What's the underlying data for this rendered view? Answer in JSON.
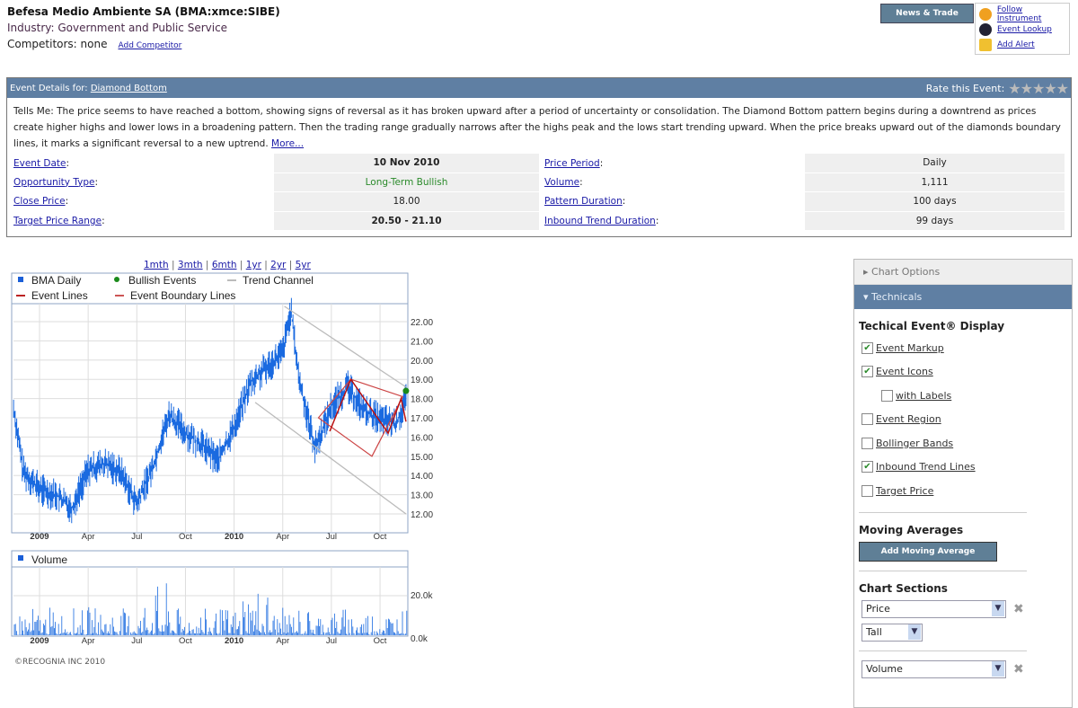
{
  "header": {
    "title": "Befesa Medio Ambiente SA (BMA:xmce:SIBE)",
    "industry": "Industry: Government and Public Service",
    "competitors": "Competitors: none",
    "add_competitor": "Add Competitor"
  },
  "actions": {
    "news_trade": "News & Trade",
    "follow": "Follow Instrument",
    "lookup": "Event Lookup",
    "alert": "Add Alert"
  },
  "event": {
    "label": "Event Details for:",
    "name": "Diamond Bottom",
    "rate_label": "Rate this Event:",
    "rating": 0,
    "tells": "Tells Me: The price seems to have reached a bottom, showing signs of reversal as it has broken upward after a period of uncertainty or consolidation. The Diamond Bottom pattern begins during a downtrend as prices create higher highs and lower lows in a broadening pattern. Then the trading range gradually narrows after the highs peak and the lows start trending upward. When the price breaks upward out of the diamonds boundary lines, it marks a significant reversal to a new uptrend.",
    "more": "More...",
    "rows": [
      {
        "l1": "Event Date",
        "v1": "10 Nov 2010",
        "l2": "Price Period",
        "v2": "Daily"
      },
      {
        "l1": "Opportunity Type",
        "v1": "Long-Term Bullish",
        "l2": "Volume",
        "v2": "1,111"
      },
      {
        "l1": "Close Price",
        "v1": "18.00",
        "l2": "Pattern Duration",
        "v2": "100 days"
      },
      {
        "l1": "Target Price Range",
        "v1": "20.50 - 21.10",
        "l2": "Inbound Trend Duration",
        "v2": "99 days"
      }
    ]
  },
  "ranges": [
    "1mth",
    "3mth",
    "6mth",
    "1yr",
    "2yr",
    "5yr"
  ],
  "chart_data": {
    "type": "line",
    "legend": [
      "BMA Daily",
      "Bullish Events",
      "Trend Channel",
      "Event Lines",
      "Event Boundary Lines"
    ],
    "x_ticks": [
      "2009",
      "Apr",
      "Jul",
      "Oct",
      "2010",
      "Apr",
      "Jul",
      "Oct"
    ],
    "y_ticks": [
      "22.00",
      "21.00",
      "20.00",
      "19.00",
      "18.00",
      "17.00",
      "16.00",
      "15.00",
      "14.00",
      "13.00",
      "12.00"
    ],
    "ylim": [
      11,
      23
    ],
    "months_from_jan2009": [
      -1.6,
      -1,
      0,
      1,
      2,
      3,
      4,
      5,
      6,
      7,
      8,
      9,
      10,
      11,
      12,
      13,
      14,
      15,
      15.5,
      16,
      17,
      18,
      19,
      20,
      21,
      22,
      22.6
    ],
    "price": [
      17.5,
      14.2,
      13.3,
      13,
      12.3,
      14.3,
      14.6,
      14.2,
      12.5,
      14.5,
      17.2,
      16.2,
      15.6,
      14.8,
      16.5,
      18.8,
      19.6,
      20.4,
      22.6,
      19,
      15.4,
      17.6,
      18.6,
      17.4,
      16.9,
      16.7,
      17.9
    ],
    "bullish_event": {
      "month": 22.6,
      "price": 18.4
    },
    "trend_channel": [
      [
        [
          15.1,
          22.8
        ],
        [
          22.6,
          18.6
        ]
      ],
      [
        [
          13.3,
          17.8
        ],
        [
          22.6,
          12.0
        ]
      ]
    ],
    "diamond": [
      [
        17.2,
        17.0
      ],
      [
        19.2,
        19.0
      ],
      [
        22.4,
        18.1
      ],
      [
        20.5,
        15.0
      ]
    ],
    "event_lines": [
      [
        17.9,
        16.3
      ],
      [
        19.2,
        19.0
      ],
      [
        21.5,
        16.2
      ],
      [
        22.3,
        18.0
      ],
      [
        22.6,
        16.8
      ]
    ],
    "volume": {
      "legend": "Volume",
      "y_ticks": [
        "20.0k",
        "0.0k"
      ],
      "ylim": [
        0,
        35
      ]
    }
  },
  "copyright": "©RECOGNIA INC 2010",
  "sidebar": {
    "chart_options": "Chart Options",
    "technicals": "Technicals",
    "display_title": "Techical Event® Display",
    "options": [
      {
        "label": "Event Markup",
        "checked": true
      },
      {
        "label": "Event Icons",
        "checked": true
      },
      {
        "label": "with Labels",
        "checked": false
      },
      {
        "label": "Event Region",
        "checked": false
      },
      {
        "label": "Bollinger Bands",
        "checked": false
      },
      {
        "label": "Inbound Trend Lines",
        "checked": true
      },
      {
        "label": "Target Price",
        "checked": false
      }
    ],
    "ma_title": "Moving Averages",
    "add_ma": "Add Moving Average",
    "sections_title": "Chart Sections",
    "section1": "Price",
    "size1": "Tall",
    "section2": "Volume"
  }
}
